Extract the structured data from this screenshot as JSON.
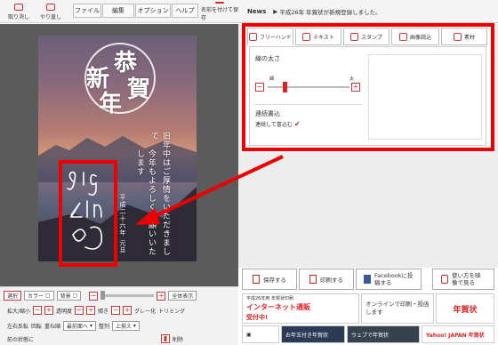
{
  "toolbar": {
    "undo": "取り消し",
    "redo": "やり直し",
    "menus": [
      "ファイル",
      "編集",
      "オプション",
      "ヘルプ"
    ],
    "save_as": "名前を付けて保存"
  },
  "news": {
    "label": "News",
    "text": "平成26年 年賀状が新規登録しました。"
  },
  "card": {
    "title_chars": [
      "新",
      "恭",
      "年",
      "賀"
    ],
    "greeting": "旧年中はご厚情をいただきまして",
    "greeting2": "今年もよろしくお願いいたします",
    "date": "平成二十六年 元旦",
    "sign": "gigazine"
  },
  "tabs": [
    "フリーハンド",
    "テキスト",
    "スタンプ",
    "画像読込",
    "素材"
  ],
  "panel": {
    "pen_width_label": "線の太さ",
    "thin": "細",
    "thick": "太",
    "continuous_label": "連続書込",
    "continuous_check": "連続して書込む",
    "slider_level": 0.18
  },
  "bottom": {
    "row1": {
      "select": "選択",
      "color": "カラー",
      "bg": "背景",
      "zoom_label": "全体表示"
    },
    "row2": [
      "拡大/縮小",
      "透明度",
      "傾き",
      "グレー化",
      "トリミング"
    ],
    "row3": [
      "左右反転",
      "回転",
      "重ね順",
      "最前面へ",
      "整列",
      "上揃え"
    ],
    "row4": [
      "前の状態に",
      "削除"
    ]
  },
  "share": {
    "save": "保存する",
    "print": "印刷する",
    "facebook": "Facebookに投稿する",
    "youtube": "使い方を映像で見る"
  },
  "ads": {
    "ad1_title": "インターネット通販",
    "ad1_sub": "平成26年用 年賀状印刷",
    "ad1_badge": "受付中!",
    "ad2": "オンラインで印刷・投函します",
    "ad3": "年賀状",
    "ad4": "お年玉付き年賀状",
    "ad5": "ウェブで年賀状",
    "ad6": "Yahoo! JAPAN 年賀状"
  }
}
